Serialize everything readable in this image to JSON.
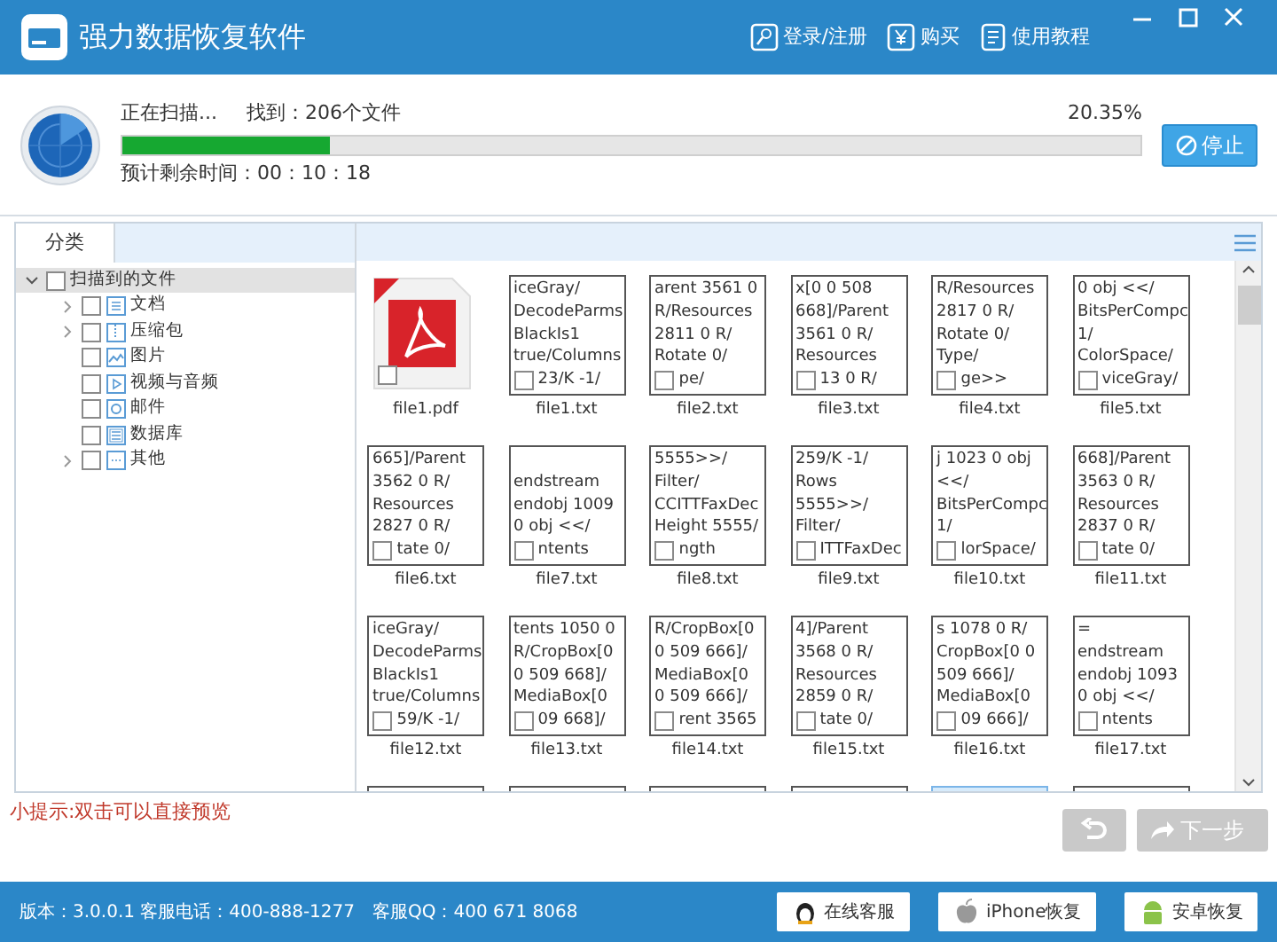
{
  "window": {
    "title": "强力数据恢复软件",
    "actions": [
      {
        "kind": "login",
        "label": "登录/注册"
      },
      {
        "kind": "buy",
        "label": "购买"
      },
      {
        "kind": "guide",
        "label": "使用教程"
      }
    ]
  },
  "scan": {
    "status": "正在扫描...",
    "found": "找到：206个文件",
    "percent": "20.35%",
    "level": 0.2035,
    "remaining": "预计剩余时间：00：10：18",
    "stop": "停止"
  },
  "sidebar": {
    "tab": "分类",
    "tree": [
      {
        "label": "扫描到的文件",
        "checked": false,
        "expanded": true,
        "children": [
          {
            "label": "文档",
            "kind": "doc",
            "checked": false,
            "expanded": false
          },
          {
            "label": "压缩包",
            "kind": "zip",
            "checked": false,
            "expanded": false
          },
          {
            "label": "图片",
            "kind": "image",
            "checked": false
          },
          {
            "label": "视频与音频",
            "kind": "video",
            "checked": false
          },
          {
            "label": "邮件",
            "kind": "mail",
            "checked": false
          },
          {
            "label": "数据库",
            "kind": "db",
            "checked": false
          },
          {
            "label": "其他",
            "kind": "other",
            "checked": false,
            "expanded": false
          }
        ]
      }
    ]
  },
  "files": [
    {
      "name": "file1.pdf",
      "kind": "pdf",
      "checked": false,
      "selected": false
    },
    {
      "name": "file1.txt",
      "kind": "txt",
      "checked": false,
      "selected": false,
      "lines": [
        "iceGray/",
        "DecodeParms",
        "BlackIs1",
        "true/Columns"
      ],
      "last": "23/K -1/"
    },
    {
      "name": "file2.txt",
      "kind": "txt",
      "checked": false,
      "selected": false,
      "lines": [
        "arent 3561 0",
        "R/Resources",
        "2811 0 R/",
        "Rotate 0/"
      ],
      "last": "pe/"
    },
    {
      "name": "file3.txt",
      "kind": "txt",
      "checked": false,
      "selected": false,
      "lines": [
        "x[0 0 508",
        "668]/Parent",
        "3561 0 R/",
        "Resources"
      ],
      "last": "13 0 R/"
    },
    {
      "name": "file4.txt",
      "kind": "txt",
      "checked": false,
      "selected": false,
      "lines": [
        "R/Resources",
        "2817 0 R/",
        "Rotate 0/",
        "Type/"
      ],
      "last": "ge>>"
    },
    {
      "name": "file5.txt",
      "kind": "txt",
      "checked": false,
      "selected": false,
      "lines": [
        "0 obj <</",
        "BitsPerCompc",
        "1/",
        "ColorSpace/"
      ],
      "last": "viceGray/"
    },
    {
      "name": "file6.txt",
      "kind": "txt",
      "checked": false,
      "selected": false,
      "lines": [
        "665]/Parent",
        "3562 0 R/",
        "Resources",
        "2827 0 R/"
      ],
      "last": "tate 0/"
    },
    {
      "name": "file7.txt",
      "kind": "txt",
      "checked": false,
      "selected": false,
      "lines": [
        "endstream",
        "endobj 1009",
        "0 obj <</"
      ],
      "last": "ntents"
    },
    {
      "name": "file8.txt",
      "kind": "txt",
      "checked": false,
      "selected": false,
      "lines": [
        "5555>>/",
        "Filter/",
        "CCITTFaxDec",
        "Height 5555/"
      ],
      "last": "ngth"
    },
    {
      "name": "file9.txt",
      "kind": "txt",
      "checked": false,
      "selected": false,
      "lines": [
        "259/K -1/",
        "Rows",
        "5555>>/",
        "Filter/"
      ],
      "last": "ITTFaxDec"
    },
    {
      "name": "file10.txt",
      "kind": "txt",
      "checked": false,
      "selected": false,
      "lines": [
        "j 1023 0 obj",
        "<</",
        "BitsPerCompc",
        "1/"
      ],
      "last": "lorSpace/"
    },
    {
      "name": "file11.txt",
      "kind": "txt",
      "checked": false,
      "selected": false,
      "lines": [
        "668]/Parent",
        "3563 0 R/",
        "Resources",
        "2837 0 R/"
      ],
      "last": "tate 0/"
    },
    {
      "name": "file12.txt",
      "kind": "txt",
      "checked": false,
      "selected": false,
      "lines": [
        "iceGray/",
        "DecodeParms",
        "BlackIs1",
        "true/Columns"
      ],
      "last": "59/K -1/"
    },
    {
      "name": "file13.txt",
      "kind": "txt",
      "checked": false,
      "selected": false,
      "lines": [
        "tents 1050 0",
        "R/CropBox[0",
        "0 509 668]/",
        "MediaBox[0"
      ],
      "last": "09 668]/"
    },
    {
      "name": "file14.txt",
      "kind": "txt",
      "checked": false,
      "selected": false,
      "lines": [
        "R/CropBox[0",
        "0 509 666]/",
        "MediaBox[0",
        "0 509 666]/"
      ],
      "last": "rent 3565"
    },
    {
      "name": "file15.txt",
      "kind": "txt",
      "checked": false,
      "selected": false,
      "lines": [
        "4]/Parent",
        "3568 0 R/",
        "Resources",
        "2859 0 R/"
      ],
      "last": "tate 0/"
    },
    {
      "name": "file16.txt",
      "kind": "txt",
      "checked": false,
      "selected": false,
      "lines": [
        "s 1078 0 R/",
        "CropBox[0 0",
        "509 666]/",
        "MediaBox[0"
      ],
      "last": "09 666]/"
    },
    {
      "name": "file17.txt",
      "kind": "txt",
      "checked": false,
      "selected": false,
      "lines": [
        "=",
        "endstream",
        "endobj 1093",
        "0 obj <</"
      ],
      "last": "ntents"
    },
    {
      "kind": "cut",
      "selected": false
    },
    {
      "kind": "cut",
      "selected": false
    },
    {
      "kind": "cut",
      "selected": false
    },
    {
      "kind": "cut",
      "selected": false
    },
    {
      "kind": "cut",
      "selected": true
    },
    {
      "kind": "cut",
      "selected": false
    }
  ],
  "tip": "小提示:双击可以直接预览",
  "nav": {
    "back_disabled": true,
    "next": "下一步",
    "next_disabled": true
  },
  "status_bar": {
    "info": "版本：3.0.0.1 客服电话：400-888-1277　客服QQ：400 671 8068",
    "buttons": [
      {
        "kind": "qq",
        "label": "在线客服"
      },
      {
        "kind": "apple",
        "label": "iPhone恢复"
      },
      {
        "kind": "android",
        "label": "安卓恢复"
      }
    ]
  }
}
